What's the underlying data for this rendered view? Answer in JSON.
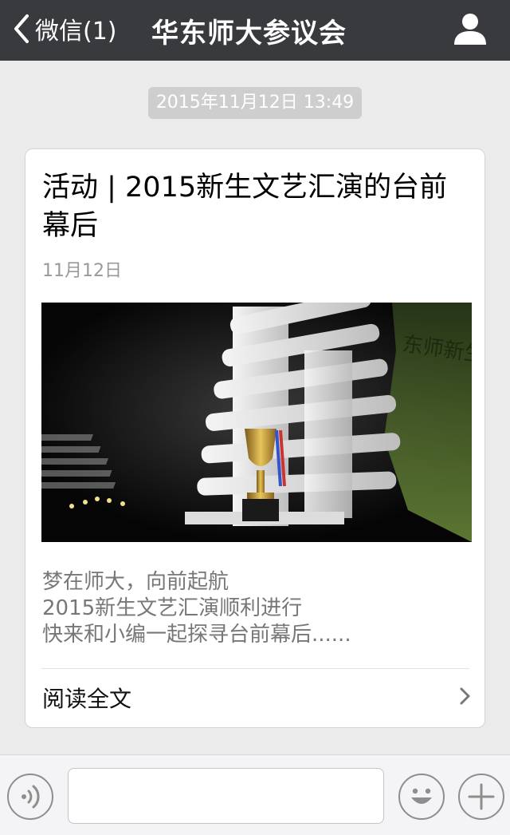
{
  "nav": {
    "back_label": "微信(1)",
    "title": "华东师大参议会"
  },
  "message": {
    "timestamp": "2015年11月12日 13:49"
  },
  "article": {
    "title": "活动 | 2015新生文艺汇演的台前幕后",
    "date": "11月12日",
    "summary": [
      "梦在师大，向前起航",
      "2015新生文艺汇演顺利进行",
      "快来和小编一起探寻台前幕后......"
    ],
    "read_more": "阅读全文",
    "banner_text": "东师新生"
  },
  "input_bar": {
    "placeholder": ""
  },
  "colors": {
    "nav_bg": "#393a3e",
    "page_bg": "#ebebeb",
    "card_bg": "#ffffff",
    "timestamp_bg": "#cecece"
  },
  "icons": {
    "back": "chevron-left-icon",
    "profile": "person-icon",
    "voice": "voice-icon",
    "emoji": "smiley-icon",
    "more": "plus-icon",
    "read_more": "chevron-right-icon"
  }
}
